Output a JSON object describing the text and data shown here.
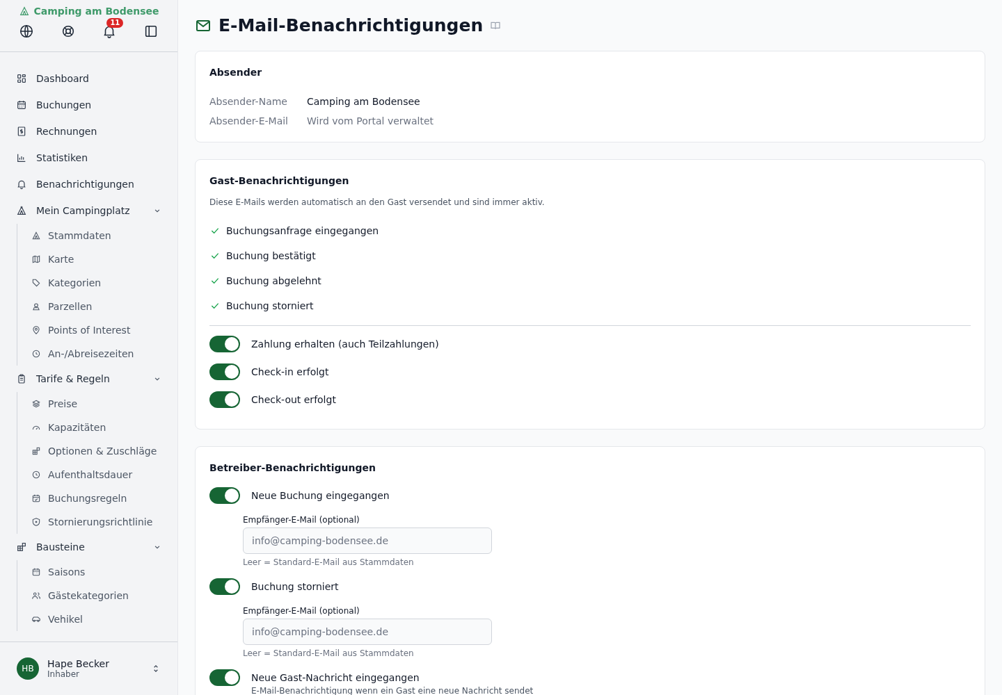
{
  "brand": {
    "name": "Camping am Bodensee"
  },
  "toolbar": {
    "notification_count": "11"
  },
  "sidebar": {
    "items": [
      {
        "label": "Dashboard"
      },
      {
        "label": "Buchungen"
      },
      {
        "label": "Rechnungen"
      },
      {
        "label": "Statistiken"
      },
      {
        "label": "Benachrichtigungen"
      },
      {
        "label": "Mein Campingplatz",
        "expanded": true,
        "children": [
          {
            "label": "Stammdaten"
          },
          {
            "label": "Karte"
          },
          {
            "label": "Kategorien"
          },
          {
            "label": "Parzellen"
          },
          {
            "label": "Points of Interest"
          },
          {
            "label": "An-/Abreisezeiten"
          }
        ]
      },
      {
        "label": "Tarife & Regeln",
        "expanded": true,
        "children": [
          {
            "label": "Preise"
          },
          {
            "label": "Kapazitäten"
          },
          {
            "label": "Optionen & Zuschläge"
          },
          {
            "label": "Aufenthaltsdauer"
          },
          {
            "label": "Buchungsregeln"
          },
          {
            "label": "Stornierungsrichtlinie"
          }
        ]
      },
      {
        "label": "Bausteine",
        "expanded": true,
        "children": [
          {
            "label": "Saisons"
          },
          {
            "label": "Gästekategorien"
          },
          {
            "label": "Vehikel"
          }
        ]
      }
    ]
  },
  "user": {
    "initials": "HB",
    "name": "Hape Becker",
    "role": "Inhaber"
  },
  "page": {
    "title": "E-Mail-Benachrichtigungen"
  },
  "sender": {
    "title": "Absender",
    "rows": [
      {
        "label": "Absender-Name",
        "value": "Camping am Bodensee",
        "muted": false
      },
      {
        "label": "Absender-E-Mail",
        "value": "Wird vom Portal verwaltet",
        "muted": true
      }
    ]
  },
  "guest": {
    "title": "Gast-Benachrichtigungen",
    "note": "Diese E-Mails werden automatisch an den Gast versendet und sind immer aktiv.",
    "always": [
      "Buchungsanfrage eingegangen",
      "Buchung bestätigt",
      "Buchung abgelehnt",
      "Buchung storniert"
    ],
    "toggles": [
      {
        "label": "Zahlung erhalten (auch Teilzahlungen)",
        "on": true
      },
      {
        "label": "Check-in erfolgt",
        "on": true
      },
      {
        "label": "Check-out erfolgt",
        "on": true
      }
    ]
  },
  "operator": {
    "title": "Betreiber-Benachrichtigungen",
    "toggles": [
      {
        "label": "Neue Buchung eingegangen",
        "on": true,
        "field_label": "Empfänger-E-Mail (optional)",
        "placeholder": "info@camping-bodensee.de",
        "hint": "Leer = Standard-E-Mail aus Stammdaten"
      },
      {
        "label": "Buchung storniert",
        "on": true,
        "field_label": "Empfänger-E-Mail (optional)",
        "placeholder": "info@camping-bodensee.de",
        "hint": "Leer = Standard-E-Mail aus Stammdaten"
      },
      {
        "label": "Neue Gast-Nachricht eingegangen",
        "on": true,
        "description": "E-Mail-Benachrichtigung wenn ein Gast eine neue Nachricht sendet"
      }
    ]
  }
}
